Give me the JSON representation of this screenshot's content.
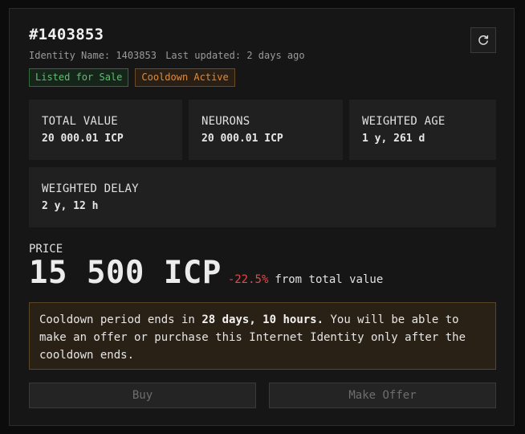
{
  "identity": {
    "title": "#1403853",
    "name_label": "Identity Name: 1403853",
    "updated_label": "Last updated: 2 days ago"
  },
  "badges": [
    {
      "label": "Listed for Sale",
      "color": "#59c26a"
    },
    {
      "label": "Cooldown Active",
      "color": "#e08a3a"
    }
  ],
  "stats": [
    {
      "label": "TOTAL VALUE",
      "value": "20 000.01 ICP"
    },
    {
      "label": "NEURONS",
      "value": "20 000.01 ICP"
    },
    {
      "label": "WEIGHTED AGE",
      "value": "1 y, 261 d"
    },
    {
      "label": "WEIGHTED DELAY",
      "value": "2 y, 12 h"
    }
  ],
  "price": {
    "label": "PRICE",
    "value": "15 500 ICP",
    "change": "-22.5%",
    "change_suffix": "from total value",
    "change_color": "#e04b4b"
  },
  "notice": {
    "prefix": "Cooldown period ends in",
    "emphasis": "28 days, 10 hours.",
    "suffix": "You will be able to make an offer or purchase this Internet Identity only after the cooldown ends."
  },
  "actions": {
    "buy_label": "Buy",
    "offer_label": "Make Offer"
  },
  "icons": {
    "refresh": "refresh-icon"
  }
}
